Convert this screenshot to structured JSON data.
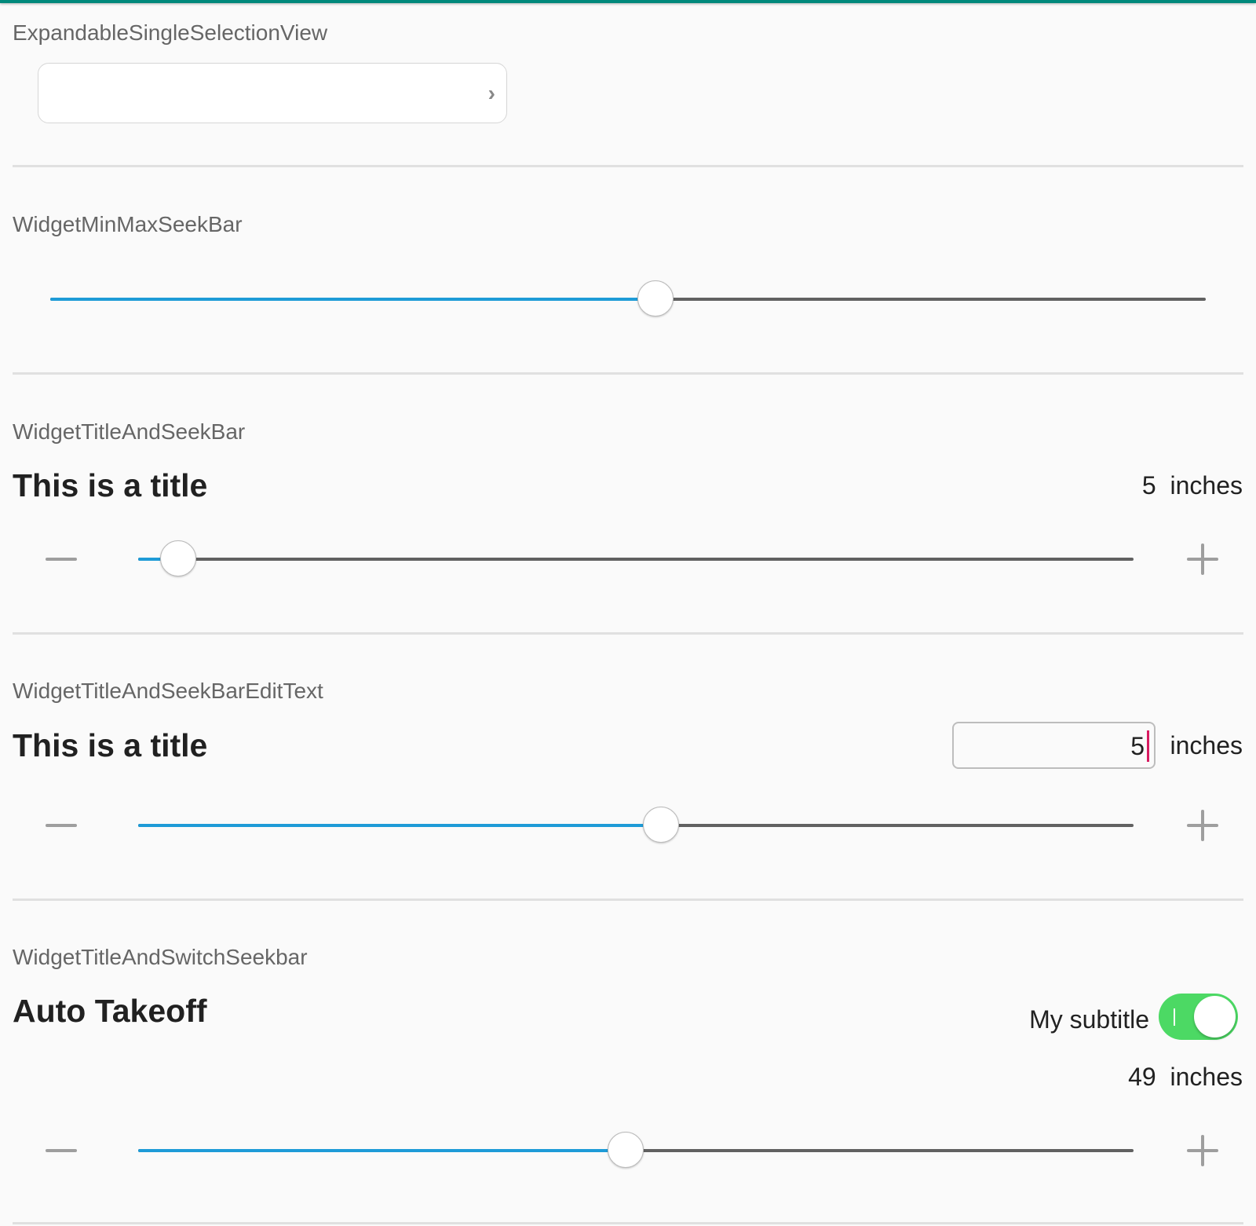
{
  "sections": {
    "expandable": {
      "label": "ExpandableSingleSelectionView",
      "value": ""
    },
    "minmax": {
      "label": "WidgetMinMaxSeekBar",
      "position": 0.524
    },
    "titleSeek": {
      "label": "WidgetTitleAndSeekBar",
      "title": "This is a title",
      "value": "5",
      "unit": "inches",
      "position": 0.04
    },
    "titleSeekEdit": {
      "label": "WidgetTitleAndSeekBarEditText",
      "title": "This is a title",
      "value": "5",
      "unit": "inches",
      "position": 0.525
    },
    "titleSwitchSeek": {
      "label": "WidgetTitleAndSwitchSeekbar",
      "title": "Auto Takeoff",
      "subtitle": "My subtitle",
      "switch_on": true,
      "value": "49",
      "unit": "inches",
      "position": 0.49
    }
  },
  "colors": {
    "accent": "#1e9bd7",
    "switch": "#4cd964",
    "topbar": "#00897b",
    "caret": "#d81b60"
  }
}
